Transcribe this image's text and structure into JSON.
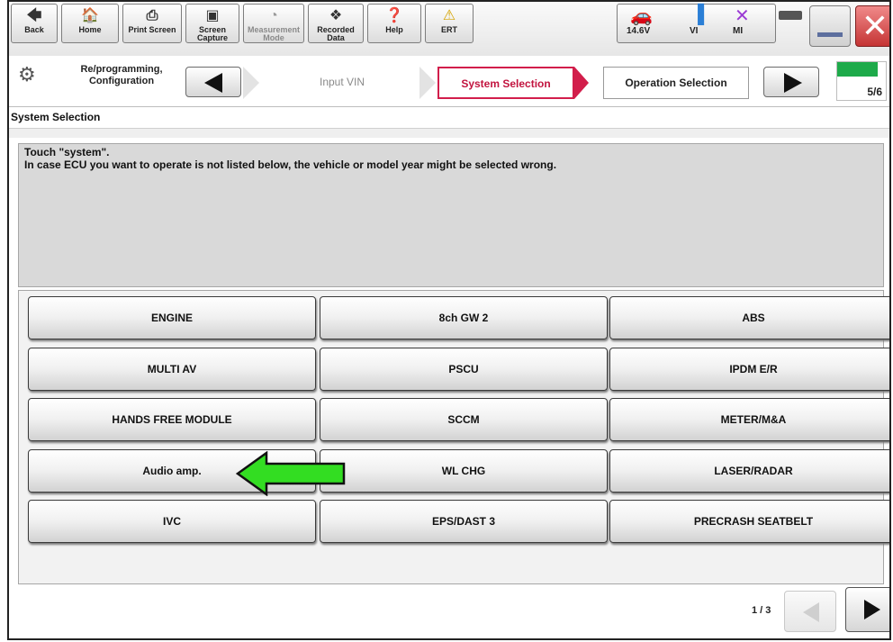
{
  "toolbar": {
    "back": "Back",
    "home": "Home",
    "print_screen": "Print Screen",
    "screen_capture": "Screen Capture",
    "measurement_mode": "Measurement Mode",
    "recorded_data": "Recorded Data",
    "help": "Help",
    "ert": "ERT",
    "voltage": "14.6V",
    "vi": "VI",
    "mi": "MI"
  },
  "stepbar": {
    "mode_line1": "Re/programming,",
    "mode_line2": "Configuration",
    "step_input_vin": "Input VIN",
    "step_system_selection": "System Selection",
    "step_operation_selection": "Operation Selection",
    "progress_label": "5/6",
    "progress_fraction": 0.83
  },
  "page": {
    "title": "System Selection",
    "message_line1": "Touch \"system\".",
    "message_line2": "In case ECU you want to operate is not listed below, the vehicle or model year might be selected wrong."
  },
  "systems": [
    "ENGINE",
    "8ch GW 2",
    "ABS",
    "MULTI AV",
    "PSCU",
    "IPDM E/R",
    "HANDS FREE MODULE",
    "SCCM",
    "METER/M&A",
    "Audio amp.",
    "WL CHG",
    "LASER/RADAR",
    "IVC",
    "EPS/DAST 3",
    "PRECRASH SEATBELT"
  ],
  "pagination": {
    "label": "1 / 3"
  },
  "colors": {
    "active_step": "#d21e4b",
    "progress": "#1eaa4a",
    "highlight_arrow": "#33dd22"
  }
}
